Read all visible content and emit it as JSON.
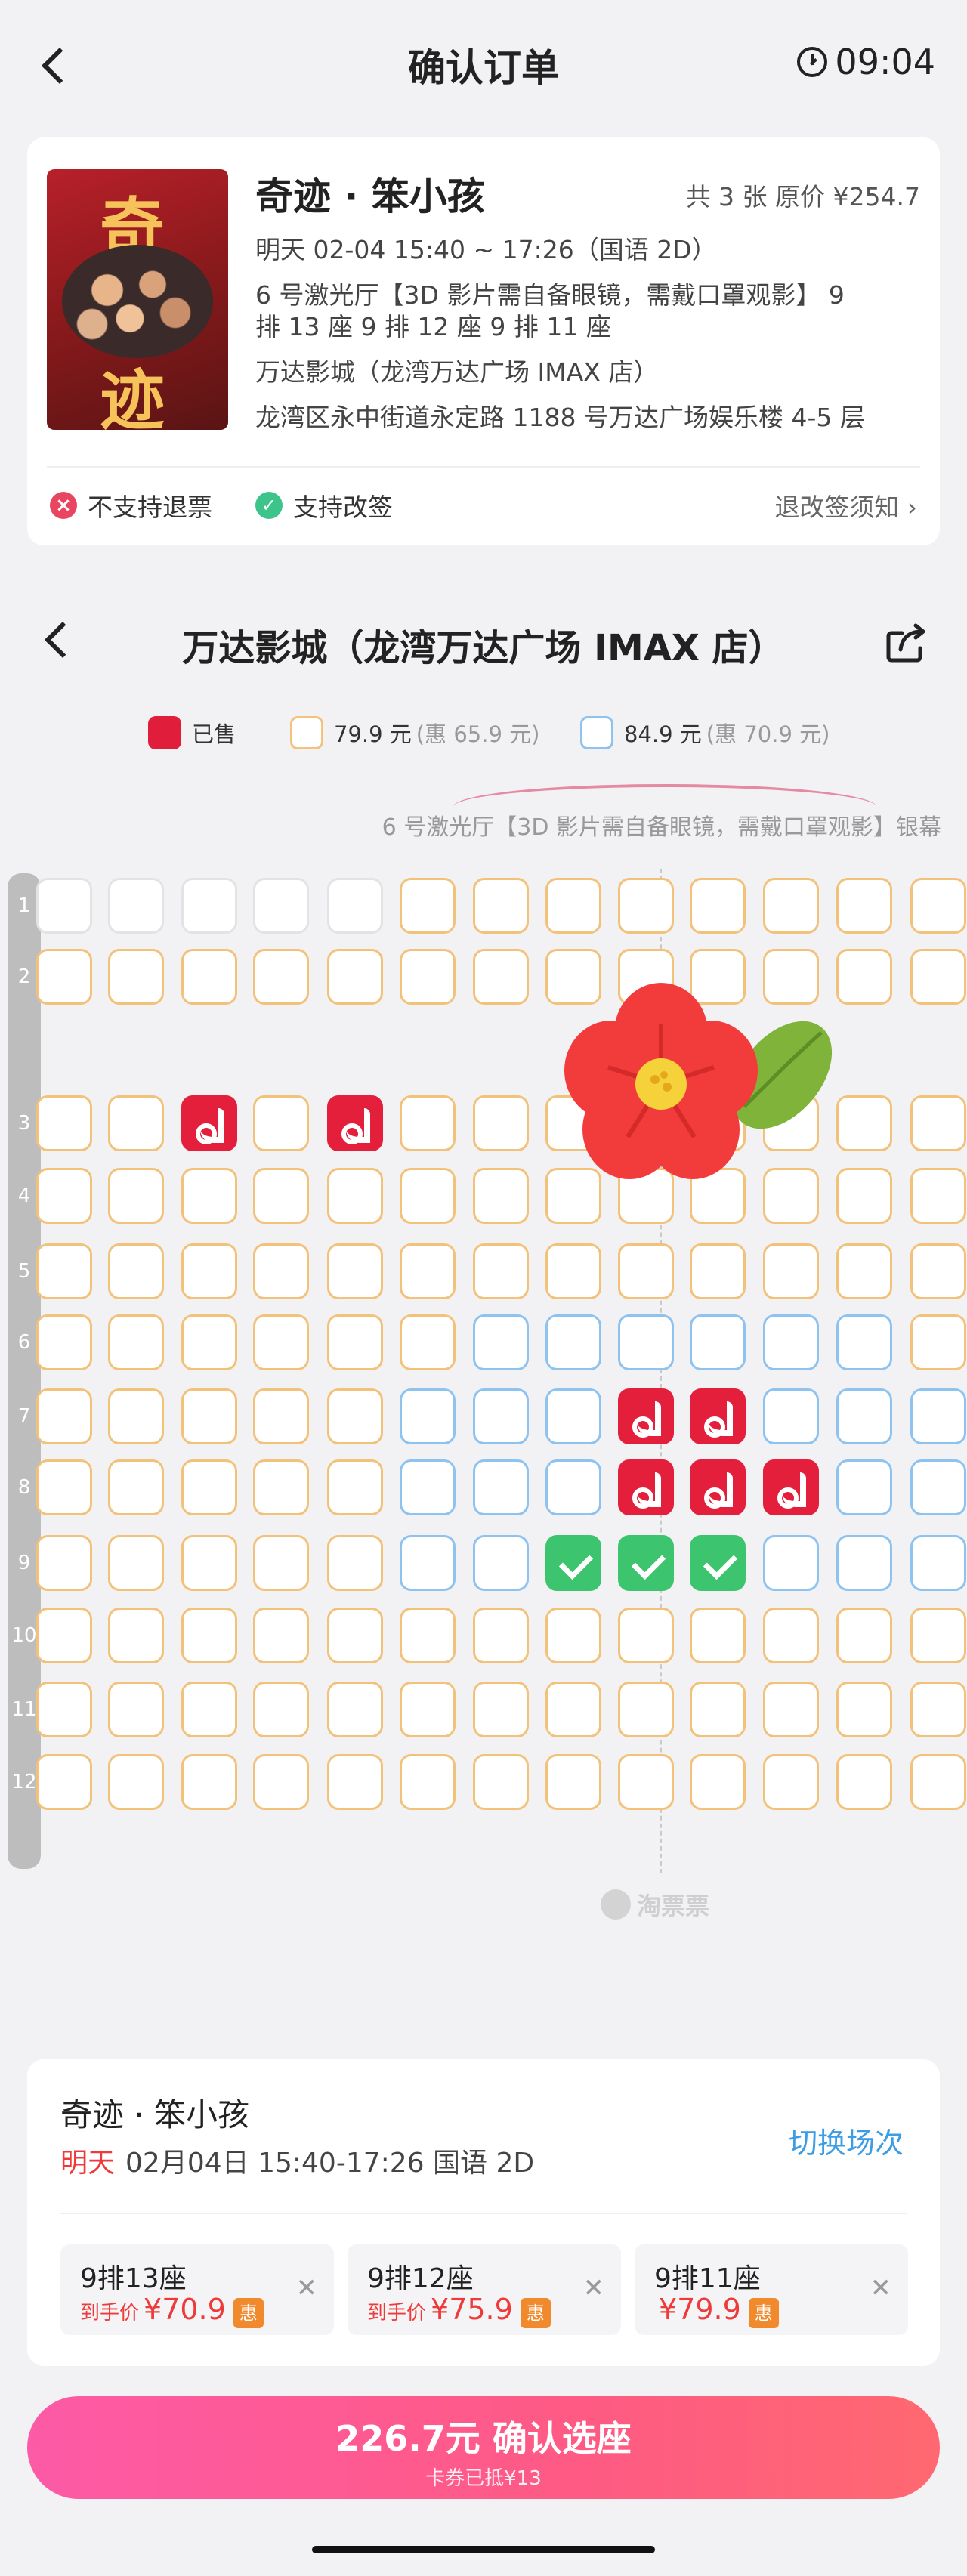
{
  "nav": {
    "title": "确认订单",
    "clock": "09:04"
  },
  "movie": {
    "title": "奇迹 · 笨小孩",
    "price_info": "共 3 张 原价 ¥254.7",
    "time": "明天 02-04 15:40 ~ 17:26（国语 2D）",
    "hall_line1": "6 号激光厅【3D 影片需自备眼镜，需戴口罩观影】 9",
    "hall_line2": "排 13 座 9 排 12 座 9 排 11 座",
    "cinema": "万达影城（龙湾万达广场 IMAX 店）",
    "address": "龙湾区永中街道永定路 1188 号万达广场娱乐楼 4-5 层",
    "poster": {
      "char1": "奇",
      "char2": "迹"
    }
  },
  "policy": {
    "no_refund": "不支持退票",
    "change_ok": "支持改签",
    "notice": "退改签须知 ›"
  },
  "cinema_header": {
    "name": "万达影城（龙湾万达广场 IMAX 店）"
  },
  "legend": {
    "sold": "已售",
    "orange_price": "79.9 元",
    "orange_sub": "(惠 65.9 元)",
    "blue_price": "84.9 元",
    "blue_sub": "(惠 70.9 元)"
  },
  "screen_label": "6 号激光厅【3D 影片需自备眼镜，需戴口罩观影】银幕",
  "seat_map": {
    "row_numbers": [
      "1",
      "2",
      "3",
      "4",
      "5",
      "6",
      "7",
      "8",
      "9",
      "10",
      "11",
      "12"
    ],
    "legend_codes": {
      "o": "79.9 元",
      "b": "84.9 元",
      "g": "unavailable",
      "S": "已售",
      "V": "selected",
      "_": "no seat"
    },
    "rows": [
      "gggggoooooooo",
      "ooooooooooooo",
      "ooSoSoooooooo",
      "ooooooooooooo",
      "ooooooooooooo",
      "oooooobbbbbbo",
      "ooooobbbSSbbb",
      "ooooobbbSSSbb",
      "ooooobbVVVbbb",
      "ooooooooooooo",
      "ooooooooooooo",
      "ooooooooooooo"
    ]
  },
  "watermark": "淘票票",
  "order": {
    "title": "奇迹 · 笨小孩",
    "day": "明天",
    "datetime": "02月04日 15:40-17:26 国语 2D",
    "switch": "切换场次",
    "tickets": [
      {
        "seat": "9排13座",
        "label": "到手价",
        "amount": "¥70.9",
        "badge": "惠"
      },
      {
        "seat": "9排12座",
        "label": "到手价",
        "amount": "¥75.9",
        "badge": "惠"
      },
      {
        "seat": "9排11座",
        "label": "",
        "amount": "¥79.9",
        "badge": "惠"
      }
    ]
  },
  "confirm": {
    "main": "226.7元 确认选座",
    "sub": "卡券已抵¥13"
  },
  "colors": {
    "accent": "#fd5aa7",
    "sold": "#e41f3c",
    "selected": "#3dc46e",
    "link": "#3c9ce4"
  }
}
